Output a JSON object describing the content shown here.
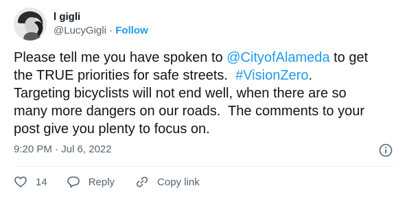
{
  "user": {
    "display_name": "l gigli",
    "handle": "@LucyGigli",
    "separator": "·",
    "follow_label": "Follow"
  },
  "tweet": {
    "text_segments": [
      {
        "text": "Please tell me you have spoken to ",
        "link": false
      },
      {
        "text": "@CityofAlameda",
        "link": true
      },
      {
        "text": " to get\nthe TRUE priorities for safe streets.  ",
        "link": false
      },
      {
        "text": "#VisionZero",
        "link": true
      },
      {
        "text": ".\nTargeting bicyclists will not end well, when there are so\nmany more dangers on our roads.  The comments to your\npost give you plenty to focus on.",
        "link": false
      }
    ],
    "time": "9:20 PM",
    "date": "Jul 6, 2022",
    "time_separator": "·"
  },
  "actions": {
    "like_count": "14",
    "reply_label": "Reply",
    "copy_label": "Copy link"
  },
  "icons": {
    "like": "heart-icon",
    "reply": "speech-bubble-icon",
    "copy": "link-icon",
    "info": "info-icon"
  },
  "colors": {
    "link": "#1d9bf0",
    "muted": "#536471",
    "text": "#0f1419"
  }
}
